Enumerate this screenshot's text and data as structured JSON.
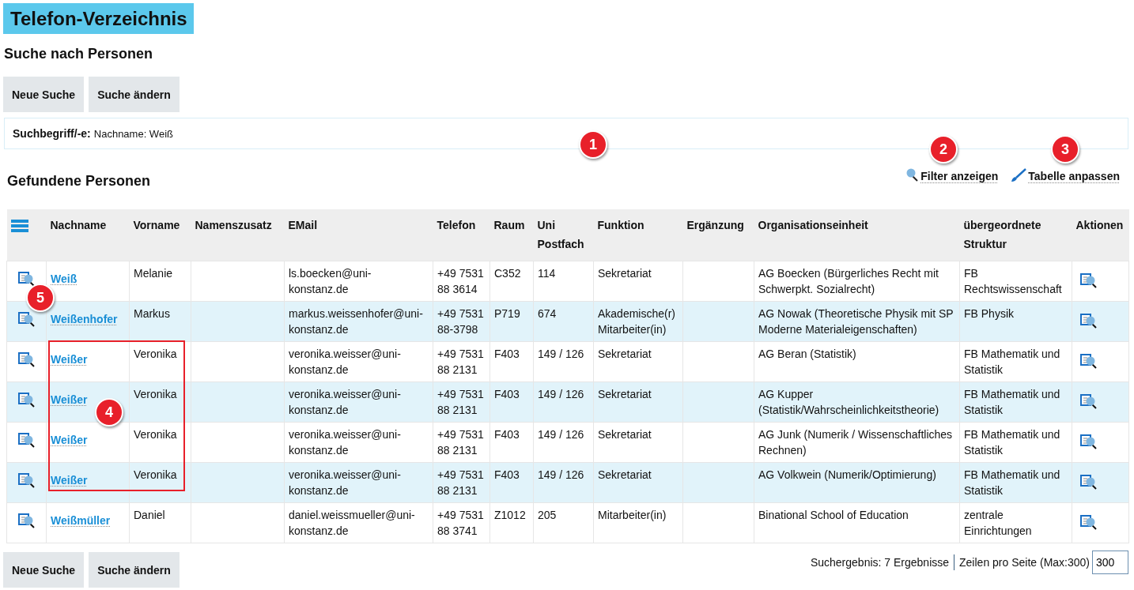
{
  "page_title": "Telefon-Verzeichnis",
  "section_title": "Suche nach Personen",
  "buttons": [
    "Neue Suche",
    "Suche ändern"
  ],
  "search_terms": {
    "label": "Suchbegriff/-e:",
    "value": "Nachname: Weiß"
  },
  "results_title": "Gefundene Personen",
  "tools": [
    {
      "kind": "filter",
      "label": "Filter anzeigen"
    },
    {
      "kind": "customize",
      "label": "Tabelle anpassen"
    }
  ],
  "table": {
    "columns": [
      "Nachname",
      "Vorname",
      "Namenszusatz",
      "EMail",
      "Telefon",
      "Raum",
      "Uni Postfach",
      "Funktion",
      "Ergänzung",
      "Organisationseinheit",
      "übergeordnete Struktur",
      "Aktionen"
    ],
    "rows": [
      {
        "nachname": "Weiß",
        "vorname": "Melanie",
        "email": "ls.boecken@uni-konstanz.de",
        "telefon": "+49 7531 88 3614",
        "raum": "C352",
        "postfach": "114",
        "funktion": "Sekretariat",
        "organisation": "AG Boecken (Bürgerliches Recht mit Schwerpkt. Sozialrecht)",
        "struktur": "FB Rechtswissenschaft"
      },
      {
        "nachname": "Weißenhofer",
        "vorname": "Markus",
        "email": "markus.weissenhofer@uni-konstanz.de",
        "telefon": "+49 7531 88-3798",
        "raum": "P719",
        "postfach": "674",
        "funktion": "Akademische(r) Mitarbeiter(in)",
        "organisation": "AG Nowak (Theoretische Physik mit SP Moderne Materialeigenschaften)",
        "struktur": "FB Physik"
      },
      {
        "nachname": "Weißer",
        "vorname": "Veronika",
        "email": "veronika.weisser@uni-konstanz.de",
        "telefon": "+49 7531 88 2131",
        "raum": "F403",
        "postfach": "149 / 126",
        "funktion": "Sekretariat",
        "organisation": "AG Beran (Statistik)",
        "struktur": "FB Mathematik und Statistik"
      },
      {
        "nachname": "Weißer",
        "vorname": "Veronika",
        "email": "veronika.weisser@uni-konstanz.de",
        "telefon": "+49 7531 88 2131",
        "raum": "F403",
        "postfach": "149 / 126",
        "funktion": "Sekretariat",
        "organisation": "AG Kupper (Statistik/Wahrscheinlichkeitstheorie)",
        "struktur": "FB Mathematik und Statistik"
      },
      {
        "nachname": "Weißer",
        "vorname": "Veronika",
        "email": "veronika.weisser@uni-konstanz.de",
        "telefon": "+49 7531 88 2131",
        "raum": "F403",
        "postfach": "149 / 126",
        "funktion": "Sekretariat",
        "organisation": "AG Junk (Numerik / Wissenschaftliches Rechnen)",
        "struktur": "FB Mathematik und Statistik"
      },
      {
        "nachname": "Weißer",
        "vorname": "Veronika",
        "email": "veronika.weisser@uni-konstanz.de",
        "telefon": "+49 7531 88 2131",
        "raum": "F403",
        "postfach": "149 / 126",
        "funktion": "Sekretariat",
        "organisation": "AG Volkwein (Numerik/Optimierung)",
        "struktur": "FB Mathematik und Statistik"
      },
      {
        "nachname": "Weißmüller",
        "vorname": "Daniel",
        "email": "daniel.weissmueller@uni-konstanz.de",
        "telefon": "+49 7531 88 3741",
        "raum": "Z1012",
        "postfach": "205",
        "funktion": "Mitarbeiter(in)",
        "organisation": "Binational School of Education",
        "struktur": "zentrale Einrichtungen"
      }
    ]
  },
  "footer": {
    "buttons": [
      "Neue Suche",
      "Suche ändern"
    ],
    "result_count": "Suchergebnis: 7 Ergebnisse",
    "rows_label": "Zeilen pro Seite (Max:300)",
    "rows_value": "300"
  },
  "annotations": [
    {
      "number": "1"
    },
    {
      "number": "2"
    },
    {
      "number": "3"
    },
    {
      "number": "4"
    },
    {
      "number": "5"
    }
  ]
}
